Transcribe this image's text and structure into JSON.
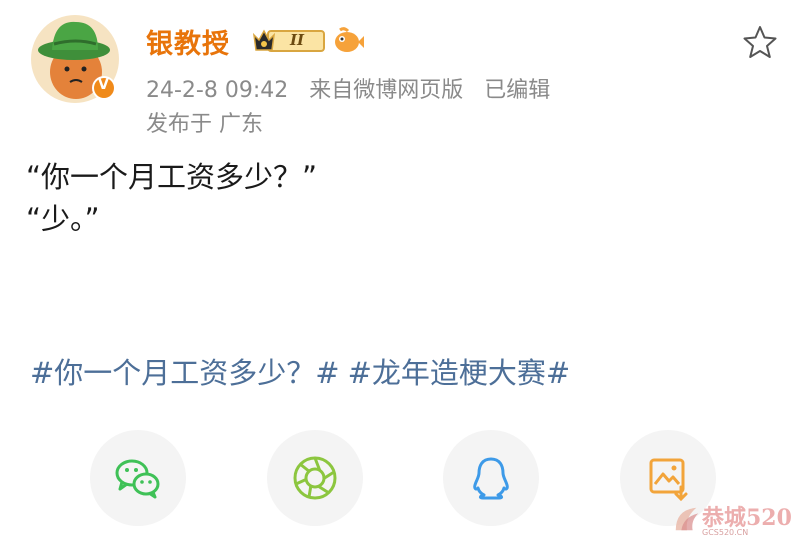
{
  "post": {
    "author": "银教授",
    "verified": "V",
    "level_badge": "II",
    "timestamp": "24-2-8 09:42",
    "source": "来自微博网页版",
    "edited": "已编辑",
    "location": "发布于 广东",
    "content_lines": [
      "“你一个月工资多少？”",
      "“少。”"
    ],
    "hashtags": [
      "#你一个月工资多少？#",
      "#龙年造梗大赛#"
    ]
  },
  "share": {
    "items": [
      {
        "icon": "wechat-icon"
      },
      {
        "icon": "moments-icon"
      },
      {
        "icon": "qq-icon"
      },
      {
        "icon": "save-image-icon"
      }
    ]
  },
  "watermark": {
    "text": "恭城520",
    "sub": "GCS520.CN"
  },
  "colors": {
    "name": "#e8740a",
    "tag": "#4d6f98",
    "meta": "#8a8a8a",
    "wechat": "#3fc157",
    "moments": "#8cc63f",
    "qq": "#3d9ae8",
    "save": "#f2a43a"
  }
}
